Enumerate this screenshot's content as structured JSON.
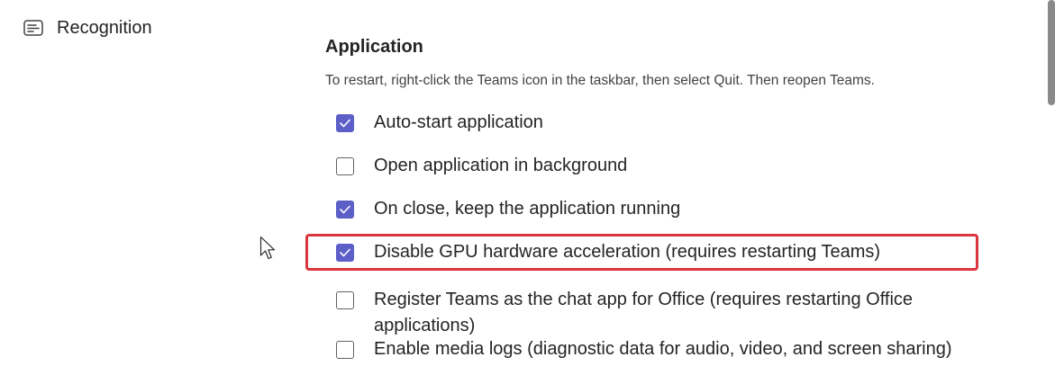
{
  "sidebar": {
    "items": [
      {
        "label": "Recognition",
        "icon": "caption-icon"
      }
    ]
  },
  "application": {
    "title": "Application",
    "description": "To restart, right-click the Teams icon in the taskbar, then select Quit. Then reopen Teams.",
    "options": [
      {
        "label": "Auto-start application",
        "checked": true
      },
      {
        "label": "Open application in background",
        "checked": false
      },
      {
        "label": "On close, keep the application running",
        "checked": true
      },
      {
        "label": "Disable GPU hardware acceleration (requires restarting Teams)",
        "checked": true,
        "highlighted": true
      },
      {
        "label": "Register Teams as the chat app for Office (requires restarting Office applications)",
        "checked": false
      },
      {
        "label": "Enable media logs (diagnostic data for audio, video, and screen sharing)",
        "checked": false
      }
    ]
  },
  "colors": {
    "accent": "#5b5fc7",
    "highlight_border": "#d9363e"
  }
}
